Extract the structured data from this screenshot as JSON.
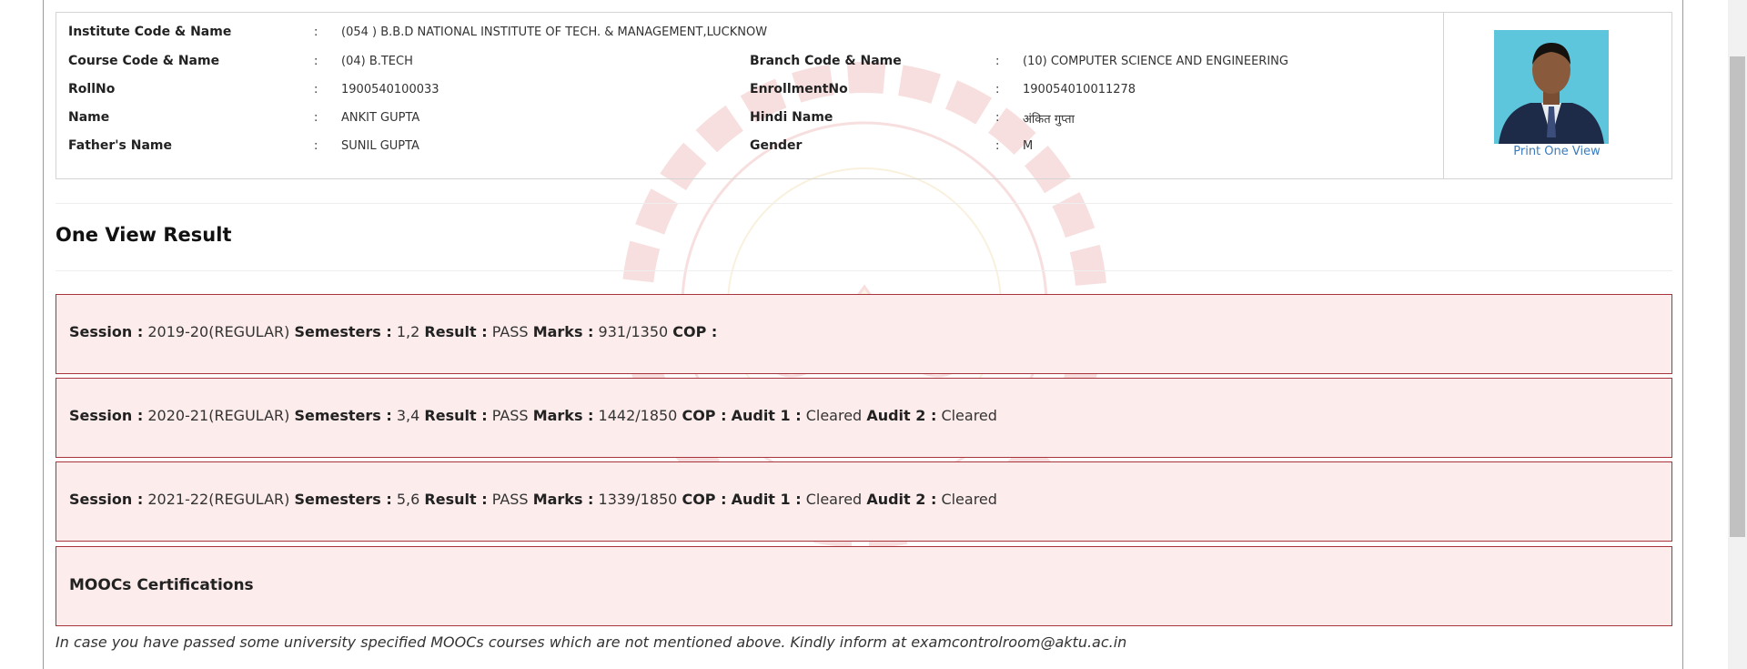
{
  "student_info": {
    "institute": {
      "label": "Institute Code & Name",
      "value": "(054 ) B.B.D NATIONAL INSTITUTE OF TECH. & MANAGEMENT,LUCKNOW"
    },
    "course": {
      "label": "Course Code & Name",
      "value": "(04) B.TECH"
    },
    "branch": {
      "label": "Branch Code & Name",
      "value": "(10) COMPUTER SCIENCE AND ENGINEERING"
    },
    "rollno": {
      "label": "RollNo",
      "value": "1900540100033"
    },
    "enrollment": {
      "label": "EnrollmentNo",
      "value": "190054010011278"
    },
    "name": {
      "label": "Name",
      "value": "ANKIT GUPTA"
    },
    "hindi_name": {
      "label": "Hindi Name",
      "value": "अंकित गुप्ता"
    },
    "father": {
      "label": "Father's Name",
      "value": "SUNIL GUPTA"
    },
    "gender": {
      "label": "Gender",
      "value": "M"
    },
    "separator": ":"
  },
  "photo": {
    "print_link": "Print One View"
  },
  "page_title": "One View Result",
  "labels": {
    "session": "Session :",
    "semesters": "Semesters :",
    "result": "Result :",
    "marks": "Marks :",
    "cop": "COP :",
    "audit1": "Audit 1 :",
    "audit2": "Audit 2 :"
  },
  "sessions": [
    {
      "session": "2019-20(REGULAR)",
      "semesters": "1,2",
      "result": "PASS",
      "marks": "931/1350",
      "cop": "",
      "audit1": "",
      "audit2": ""
    },
    {
      "session": "2020-21(REGULAR)",
      "semesters": "3,4",
      "result": "PASS",
      "marks": "1442/1850",
      "cop": "",
      "audit1": "Cleared",
      "audit2": "Cleared"
    },
    {
      "session": "2021-22(REGULAR)",
      "semesters": "5,6",
      "result": "PASS",
      "marks": "1339/1850",
      "cop": "",
      "audit1": "Cleared",
      "audit2": "Cleared"
    }
  ],
  "moocs": {
    "title": "MOOCs Certifications"
  },
  "note": "In case you have passed some university specified MOOCs courses which are not mentioned above. Kindly inform at examcontrolroom@aktu.ac.in",
  "colors": {
    "result_bg": "#fdecec",
    "result_border": "#a8353d",
    "link": "#3a7bbf",
    "watermark": "#e07070"
  }
}
